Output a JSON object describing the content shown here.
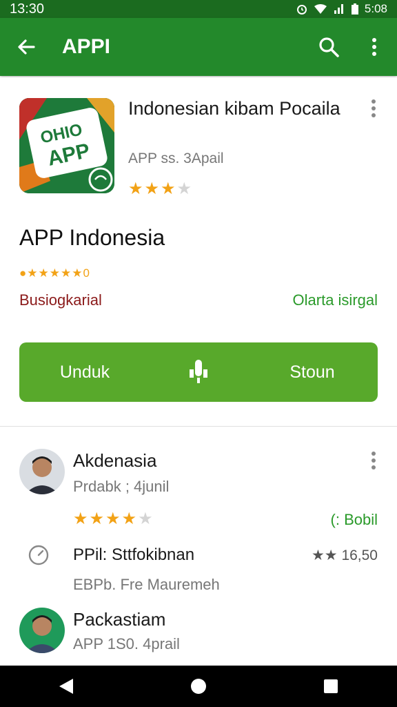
{
  "status_bar": {
    "time": "13:30",
    "right_time": "5:08"
  },
  "app_bar": {
    "title": "APPI"
  },
  "app_card": {
    "icon_text_top": "OHIO",
    "icon_text_main": "APP",
    "name": "Indonesian kibam Pocaila",
    "meta": "APP ss. 3Apail",
    "stars": 3.5,
    "headline": "APP Indonesia",
    "rating_line": "●★★★★★0",
    "category": "Busiogkarial",
    "price_status": "Olarta isirgal"
  },
  "actions": {
    "install": "Unduk",
    "store": "Stoun"
  },
  "reviews": [
    {
      "name": "Akdenasia",
      "sub": "Prdabk ; 4junil",
      "stars": 4,
      "badge": "(: Bobil"
    },
    {
      "name": "Packastiam",
      "sub": "APP 1S0. 4prail"
    }
  ],
  "detail_row": {
    "label": "PPil: Sttfokibnan",
    "rating": "★★ 16,50",
    "sub": "EBPb. Fre Mauremeh"
  },
  "colors": {
    "status_bar": "#1b6b1f",
    "app_bar": "#23892b",
    "button": "#58a92b",
    "star": "#f2a216",
    "price": "#2a9a2a",
    "category": "#8b1a1a"
  },
  "icons": [
    "back-arrow-icon",
    "search-icon",
    "more-vert-icon",
    "mic-icon",
    "clock-icon",
    "nav-back-icon",
    "nav-home-icon",
    "nav-recents-icon"
  ]
}
